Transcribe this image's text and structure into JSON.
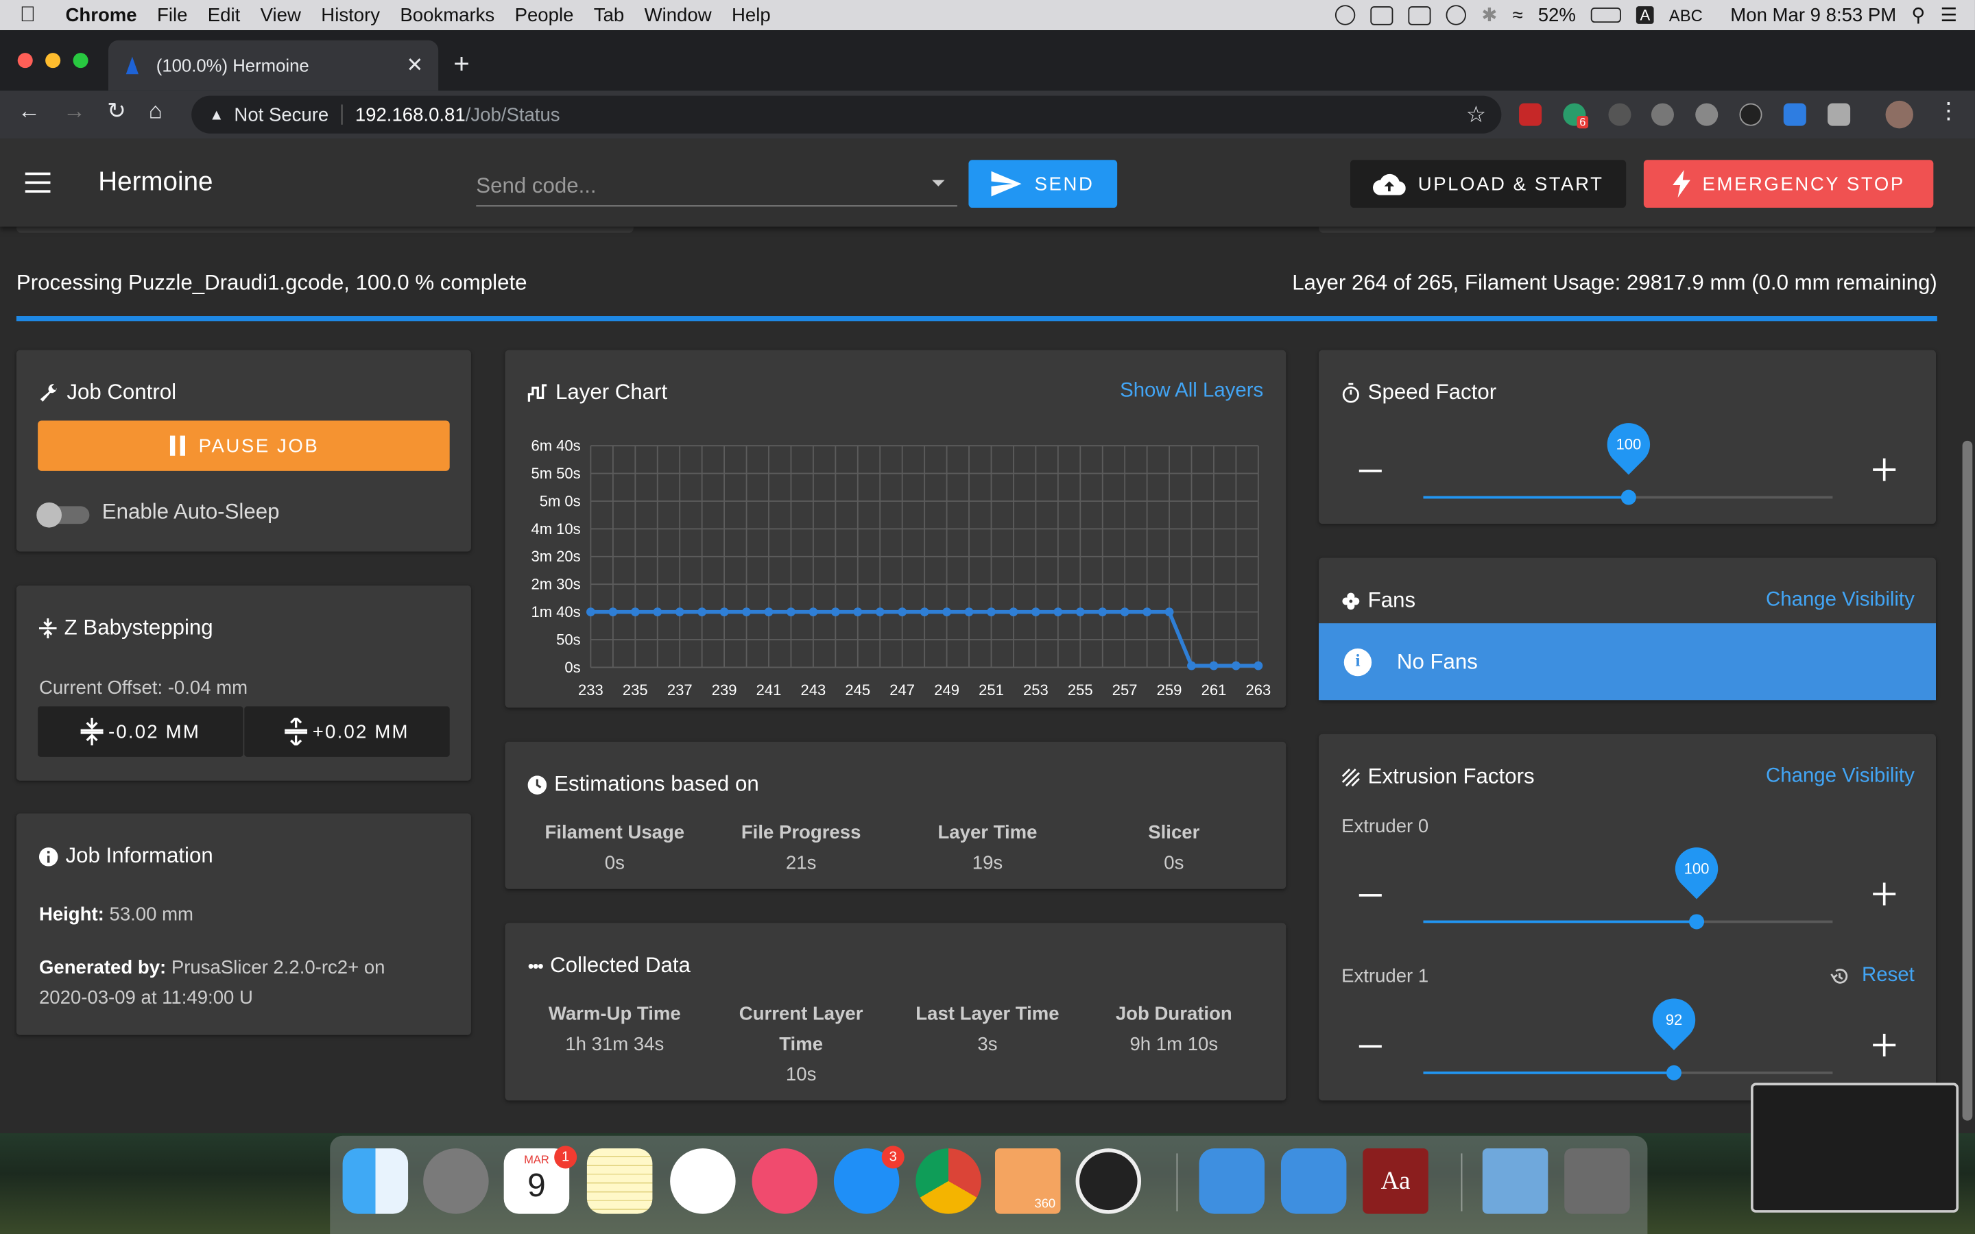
{
  "menubar": {
    "app": "Chrome",
    "items": [
      "File",
      "Edit",
      "View",
      "History",
      "Bookmarks",
      "People",
      "Tab",
      "Window",
      "Help"
    ],
    "battery": "52%",
    "input_source": "ABC",
    "clock": "Mon Mar 9  8:53 PM"
  },
  "browser": {
    "tab_title": "(100.0%) Hermoine",
    "security": "Not Secure",
    "url_host": "192.168.0.81",
    "url_path": "/Job/Status",
    "ext_badge": "6"
  },
  "appbar": {
    "title": "Hermoine",
    "code_placeholder": "Send code...",
    "send_label": "SEND",
    "upload_label": "UPLOAD & START",
    "estop_label": "EMERGENCY STOP"
  },
  "status": {
    "left": "Processing Puzzle_Draudi1.gcode, 100.0 % complete",
    "right": "Layer 264 of 265, Filament Usage: 29817.9 mm (0.0 mm remaining)",
    "progress": 1.0
  },
  "job_control": {
    "title": "Job Control",
    "pause_label": "PAUSE JOB",
    "auto_sleep_label": "Enable Auto-Sleep",
    "auto_sleep_on": false
  },
  "babystep": {
    "title": "Z Babystepping",
    "offset": "Current Offset: -0.04 mm",
    "minus_label": "-0.02 MM",
    "plus_label": "+0.02 MM"
  },
  "job_info": {
    "title": "Job Information",
    "height_label": "Height:",
    "height_value": "53.00 mm",
    "generated_label": "Generated by:",
    "generated_value": "PrusaSlicer 2.2.0-rc2+ on",
    "generated_value2": "2020-03-09 at 11:49:00 U"
  },
  "layer_chart": {
    "title": "Layer Chart",
    "link": "Show All Layers"
  },
  "chart_data": {
    "type": "line",
    "title": "",
    "xlabel": "",
    "ylabel": "",
    "x_tick_labels": [
      "233",
      "235",
      "237",
      "239",
      "241",
      "243",
      "245",
      "247",
      "249",
      "251",
      "253",
      "255",
      "257",
      "259",
      "261",
      "263"
    ],
    "y_tick_labels": [
      "0s",
      "50s",
      "1m 40s",
      "2m 30s",
      "3m 20s",
      "4m 10s",
      "5m 0s",
      "5m 50s",
      "6m 40s"
    ],
    "ylim": [
      0,
      400
    ],
    "xlim": [
      233,
      263
    ],
    "grid": true,
    "x": [
      233,
      234,
      235,
      236,
      237,
      238,
      239,
      240,
      241,
      242,
      243,
      244,
      245,
      246,
      247,
      248,
      249,
      250,
      251,
      252,
      253,
      254,
      255,
      256,
      257,
      258,
      259,
      260,
      261,
      262,
      263
    ],
    "y": [
      100,
      100,
      100,
      100,
      100,
      100,
      100,
      100,
      100,
      100,
      100,
      100,
      100,
      100,
      100,
      100,
      100,
      100,
      100,
      100,
      100,
      100,
      100,
      100,
      100,
      100,
      100,
      3,
      3,
      3,
      3
    ],
    "color": "#2f7fd6"
  },
  "estimations": {
    "title": "Estimations based on",
    "items": [
      {
        "label": "Filament Usage",
        "value": "0s"
      },
      {
        "label": "File Progress",
        "value": "21s"
      },
      {
        "label": "Layer Time",
        "value": "19s"
      },
      {
        "label": "Slicer",
        "value": "0s"
      }
    ]
  },
  "collected": {
    "title": "Collected Data",
    "items": [
      {
        "label": "Warm-Up Time",
        "value": "1h 31m 34s"
      },
      {
        "label": "Current Layer",
        "label2": "Time",
        "value": "10s"
      },
      {
        "label": "Last Layer Time",
        "value": "3s"
      },
      {
        "label": "Job Duration",
        "value": "9h 1m 10s"
      }
    ]
  },
  "speed_factor": {
    "title": "Speed Factor",
    "value": "100",
    "fraction": 0.5
  },
  "fans": {
    "title": "Fans",
    "link": "Change Visibility",
    "message": "No Fans"
  },
  "extrusion": {
    "title": "Extrusion Factors",
    "link": "Change Visibility",
    "reset_label": "Reset",
    "extruders": [
      {
        "label": "Extruder 0",
        "value": "100",
        "fraction": 0.667
      },
      {
        "label": "Extruder 1",
        "value": "92",
        "fraction": 0.613
      }
    ]
  },
  "dock": {
    "calendar_month": "MAR",
    "calendar_day": "9",
    "calendar_badge": "1",
    "appstore_badge": "3",
    "fusion_label": "360",
    "dictionary_label": "Aa"
  }
}
